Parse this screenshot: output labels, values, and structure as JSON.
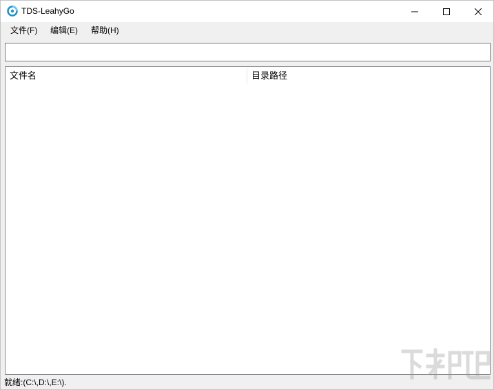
{
  "window": {
    "title": "TDS-LeahyGo",
    "app_icon": "tds-app-icon",
    "controls": [
      "minimize-icon",
      "maximize-icon",
      "close-icon"
    ]
  },
  "menu": {
    "items": [
      {
        "label": "文件(F)"
      },
      {
        "label": "编辑(E)"
      },
      {
        "label": "帮助(H)"
      }
    ]
  },
  "search": {
    "value": ""
  },
  "list": {
    "columns": [
      {
        "label": "文件名"
      },
      {
        "label": "目录路径"
      }
    ],
    "rows": []
  },
  "status": {
    "text": "就绪:(C:\\,D:\\,E:\\)."
  },
  "colors": {
    "window_bg": "#f0f0f0",
    "titlebar_bg": "#ffffff",
    "list_bg": "#ffffff",
    "app_icon_accent": "#1e90c8"
  }
}
